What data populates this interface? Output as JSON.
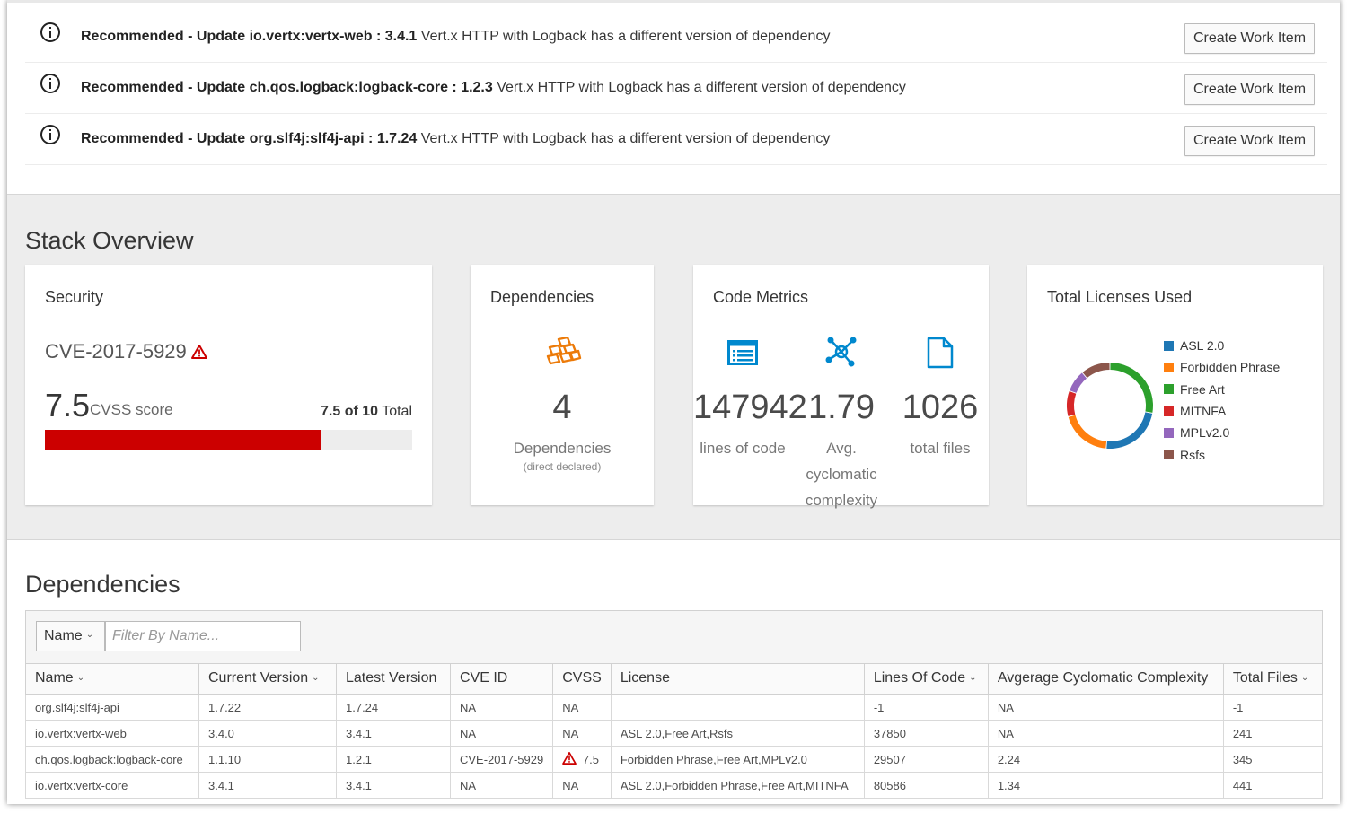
{
  "recommendations": [
    {
      "prefix": "Recommended - Update io.vertx:vertx-web : 3.4.1",
      "message": " Vert.x HTTP with Logback has a different version of dependency",
      "button": "Create Work Item"
    },
    {
      "prefix": "Recommended - Update ch.qos.logback:logback-core : 1.2.3",
      "message": " Vert.x HTTP with Logback has a different version of dependency",
      "button": "Create Work Item"
    },
    {
      "prefix": "Recommended - Update org.slf4j:slf4j-api : 1.7.24",
      "message": " Vert.x HTTP with Logback has a different version of dependency",
      "button": "Create Work Item"
    }
  ],
  "overview": {
    "title": "Stack Overview",
    "security": {
      "title": "Security",
      "cve": "CVE-2017-5929",
      "score": "7.5",
      "score_label": "CVSS score",
      "total_bold": "7.5 of 10",
      "total_suffix": " Total",
      "bar_fraction": 0.75,
      "bar_color": "#cc0000"
    },
    "dependencies": {
      "title": "Dependencies",
      "count": "4",
      "label": "Dependencies",
      "sublabel": "(direct declared)",
      "icon": "cubes-icon",
      "icon_color": "#ec7a08"
    },
    "code_metrics": {
      "title": "Code Metrics",
      "lines": "147942",
      "lines_label": "lines of code",
      "complexity": "1.79",
      "complexity_label_1": "Avg.",
      "complexity_label_2": "cyclomatic",
      "complexity_label_3": "complexity",
      "files": "1026",
      "files_label": "total files",
      "icon_color": "#0088ce"
    },
    "licenses": {
      "title": "Total Licenses Used",
      "items": [
        {
          "name": "ASL 2.0",
          "color": "#1f77b4"
        },
        {
          "name": "Forbidden Phrase",
          "color": "#ff7f0e"
        },
        {
          "name": "Free Art",
          "color": "#2ca02c"
        },
        {
          "name": "MITNFA",
          "color": "#d62728"
        },
        {
          "name": "MPLv2.0",
          "color": "#9467bd"
        },
        {
          "name": "Rsfs",
          "color": "#8c564b"
        }
      ]
    }
  },
  "dependencies": {
    "title": "Dependencies",
    "filter_field": "Name",
    "filter_placeholder": "Filter By Name...",
    "columns": [
      "Name",
      "Current Version",
      "Latest Version",
      "CVE ID",
      "CVSS",
      "License",
      "Lines Of Code",
      "Avgerage Cyclomatic Complexity",
      "Total Files"
    ],
    "rows": [
      [
        "org.slf4j:slf4j-api",
        "1.7.22",
        "1.7.24",
        "NA",
        "NA",
        "",
        "-1",
        "NA",
        "-1"
      ],
      [
        "io.vertx:vertx-web",
        "3.4.0",
        "3.4.1",
        "NA",
        "NA",
        "ASL 2.0,Free Art,Rsfs",
        "37850",
        "NA",
        "241"
      ],
      [
        "ch.qos.logback:logback-core",
        "1.1.10",
        "1.2.1",
        "CVE-2017-5929",
        "7.5",
        "Forbidden Phrase,Free Art,MPLv2.0",
        "29507",
        "2.24",
        "345"
      ],
      [
        "io.vertx:vertx-core",
        "3.4.1",
        "3.4.1",
        "NA",
        "NA",
        "ASL 2.0,Forbidden Phrase,Free Art,MITNFA",
        "80586",
        "1.34",
        "441"
      ]
    ]
  }
}
